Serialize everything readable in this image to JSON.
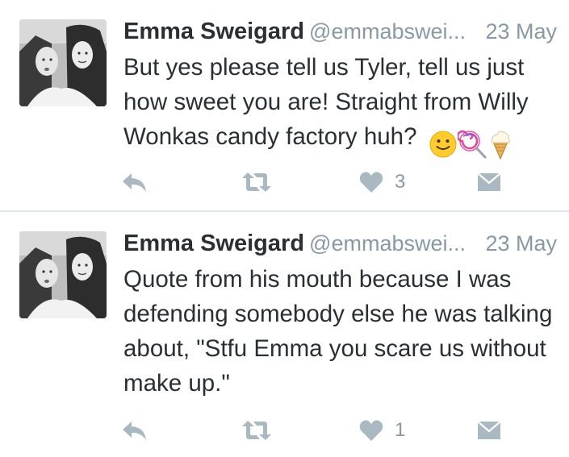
{
  "tweets": [
    {
      "author_name": "Emma Sweigard",
      "handle": "@emmabswei...",
      "date": "23 May",
      "text": "But yes please tell us Tyler, tell us just how sweet you are! Straight from Willy Wonkas candy factory huh?",
      "emojis": [
        "slightly-smiling-face-emoji",
        "lollipop-emoji",
        "ice-cream-emoji"
      ],
      "like_count": "3"
    },
    {
      "author_name": "Emma Sweigard",
      "handle": "@emmabswei...",
      "date": "23 May",
      "text": "Quote from his mouth because I was defending somebody else he was talking about, \"Stfu Emma you scare us without make up.\"",
      "like_count": "1"
    }
  ],
  "colors": {
    "text": "#292f33",
    "secondary": "#8899a6",
    "icon": "#aab8c2",
    "divider": "#e1e8ed"
  }
}
